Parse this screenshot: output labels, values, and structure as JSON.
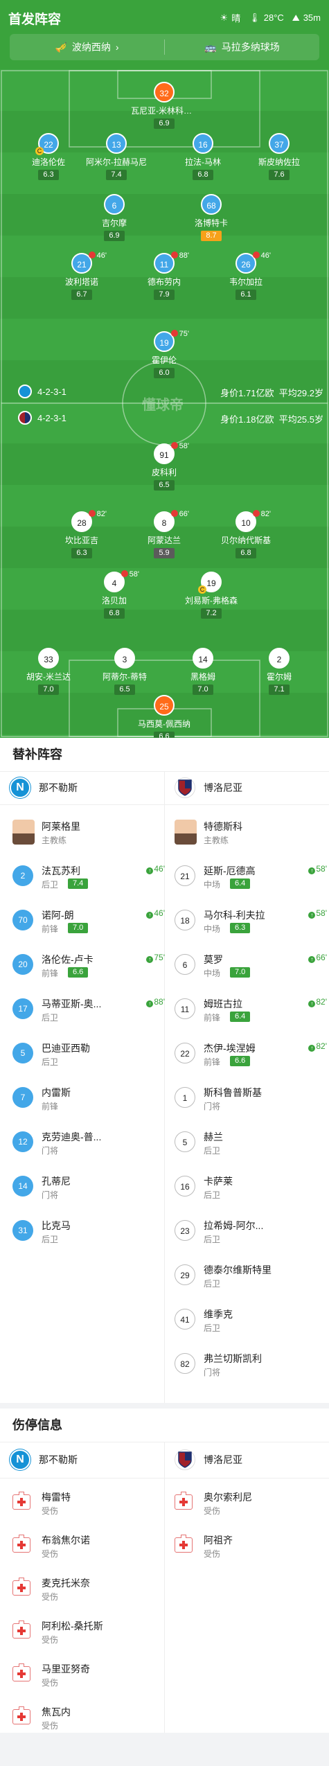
{
  "header": {
    "title": "首发阵容",
    "weather": "晴",
    "temperature": "28°C",
    "altitude": "35m"
  },
  "venue": {
    "referee": "波纳西纳",
    "stadium": "马拉多纳球场"
  },
  "formation": {
    "home": {
      "shape": "4-2-3-1",
      "value": "身价1.71亿欧",
      "age": "平均29.2岁"
    },
    "away": {
      "shape": "4-2-3-1",
      "value": "身价1.18亿欧",
      "age": "平均25.5岁"
    }
  },
  "watermark": "懂球帝",
  "pitch_home": [
    {
      "no": "32",
      "name": "瓦尼亚-米林科维...",
      "rating": "6.9"
    },
    {
      "no": "22",
      "name": "迪洛伦佐",
      "rating": "6.3",
      "captain": "C"
    },
    {
      "no": "13",
      "name": "阿米尔-拉赫马尼",
      "rating": "7.4"
    },
    {
      "no": "16",
      "name": "拉法-马林",
      "rating": "6.8"
    },
    {
      "no": "37",
      "name": "斯皮纳佐拉",
      "rating": "7.6"
    },
    {
      "no": "6",
      "name": "吉尔摩",
      "rating": "6.9"
    },
    {
      "no": "68",
      "name": "洛博特卡",
      "rating": "8.7"
    },
    {
      "no": "21",
      "name": "波利塔诺",
      "rating": "6.7",
      "sub": "46'"
    },
    {
      "no": "11",
      "name": "德布劳内",
      "rating": "7.9",
      "sub": "88'"
    },
    {
      "no": "26",
      "name": "韦尔加拉",
      "rating": "6.1",
      "sub": "46'"
    },
    {
      "no": "19",
      "name": "霍伊伦",
      "rating": "6.0",
      "sub": "75'"
    }
  ],
  "pitch_away": [
    {
      "no": "91",
      "name": "皮科利",
      "rating": "6.5",
      "sub": "58'"
    },
    {
      "no": "28",
      "name": "坎比亚吉",
      "rating": "6.3",
      "sub": "82'"
    },
    {
      "no": "8",
      "name": "阿蒙达兰",
      "rating": "5.9",
      "sub": "66'"
    },
    {
      "no": "10",
      "name": "贝尔纳代斯基",
      "rating": "6.8",
      "sub": "82'"
    },
    {
      "no": "4",
      "name": "洛贝加",
      "rating": "6.8",
      "sub": "58'"
    },
    {
      "no": "19",
      "name": "刘易斯-弗格森",
      "rating": "7.2",
      "captain": "C"
    },
    {
      "no": "33",
      "name": "胡安-米兰达",
      "rating": "7.0"
    },
    {
      "no": "3",
      "name": "阿蒂尔-蒂特",
      "rating": "6.5"
    },
    {
      "no": "14",
      "name": "黑格姆",
      "rating": "7.0"
    },
    {
      "no": "2",
      "name": "霍尔姆",
      "rating": "7.1"
    },
    {
      "no": "25",
      "name": "马西莫-佩西纳",
      "rating": "6.6"
    }
  ],
  "subs": {
    "title": "替补阵容",
    "home_team": "那不勒斯",
    "away_team": "博洛尼亚",
    "home_coach": {
      "name": "阿莱格里",
      "role": "主教练"
    },
    "away_coach": {
      "name": "特德斯科",
      "role": "主教练"
    },
    "home": [
      {
        "no": "2",
        "name": "法瓦苏利",
        "pos": "后卫",
        "rating": "7.4",
        "time": "46'"
      },
      {
        "no": "70",
        "name": "诺阿-朗",
        "pos": "前锋",
        "rating": "7.0",
        "time": "46'"
      },
      {
        "no": "20",
        "name": "洛伦佐-卢卡",
        "pos": "前锋",
        "rating": "6.6",
        "time": "75'"
      },
      {
        "no": "17",
        "name": "马蒂亚斯-奥...",
        "pos": "后卫",
        "rating": "",
        "time": "88'"
      },
      {
        "no": "5",
        "name": "巴迪亚西勒",
        "pos": "后卫",
        "rating": "",
        "time": ""
      },
      {
        "no": "7",
        "name": "内雷斯",
        "pos": "前锋",
        "rating": "",
        "time": ""
      },
      {
        "no": "12",
        "name": "克劳迪奥-普...",
        "pos": "门将",
        "rating": "",
        "time": ""
      },
      {
        "no": "14",
        "name": "孔蒂尼",
        "pos": "门将",
        "rating": "",
        "time": ""
      },
      {
        "no": "31",
        "name": "比克马",
        "pos": "后卫",
        "rating": "",
        "time": ""
      }
    ],
    "away": [
      {
        "no": "21",
        "name": "延斯-厄德高",
        "pos": "中场",
        "rating": "6.4",
        "time": "58'"
      },
      {
        "no": "18",
        "name": "马尔科-利夫拉",
        "pos": "中场",
        "rating": "6.3",
        "time": "58'"
      },
      {
        "no": "6",
        "name": "莫罗",
        "pos": "中场",
        "rating": "7.0",
        "time": "66'"
      },
      {
        "no": "11",
        "name": "姆班古拉",
        "pos": "前锋",
        "rating": "6.4",
        "time": "82'"
      },
      {
        "no": "22",
        "name": "杰伊-埃涅姆",
        "pos": "前锋",
        "rating": "6.6",
        "time": "82'"
      },
      {
        "no": "1",
        "name": "斯科鲁普斯基",
        "pos": "门将",
        "rating": "",
        "time": ""
      },
      {
        "no": "5",
        "name": "赫兰",
        "pos": "后卫",
        "rating": "",
        "time": ""
      },
      {
        "no": "16",
        "name": "卡萨莱",
        "pos": "后卫",
        "rating": "",
        "time": ""
      },
      {
        "no": "23",
        "name": "拉希姆-阿尔...",
        "pos": "后卫",
        "rating": "",
        "time": ""
      },
      {
        "no": "29",
        "name": "德泰尔维斯特里",
        "pos": "后卫",
        "rating": "",
        "time": ""
      },
      {
        "no": "41",
        "name": "维季克",
        "pos": "后卫",
        "rating": "",
        "time": ""
      },
      {
        "no": "82",
        "name": "弗兰切斯凯利",
        "pos": "门将",
        "rating": "",
        "time": ""
      }
    ]
  },
  "injuries": {
    "title": "伤停信息",
    "home_team": "那不勒斯",
    "away_team": "博洛尼亚",
    "home": [
      {
        "name": "梅雷特",
        "status": "受伤"
      },
      {
        "name": "布翁焦尔诺",
        "status": "受伤"
      },
      {
        "name": "麦克托米奈",
        "status": "受伤"
      },
      {
        "name": "阿利松-桑托斯",
        "status": "受伤"
      },
      {
        "name": "马里亚努奇",
        "status": "受伤"
      },
      {
        "name": "焦瓦内",
        "status": "受伤"
      }
    ],
    "away": [
      {
        "name": "奥尔索利尼",
        "status": "受伤"
      },
      {
        "name": "阿祖齐",
        "status": "受伤"
      }
    ]
  }
}
